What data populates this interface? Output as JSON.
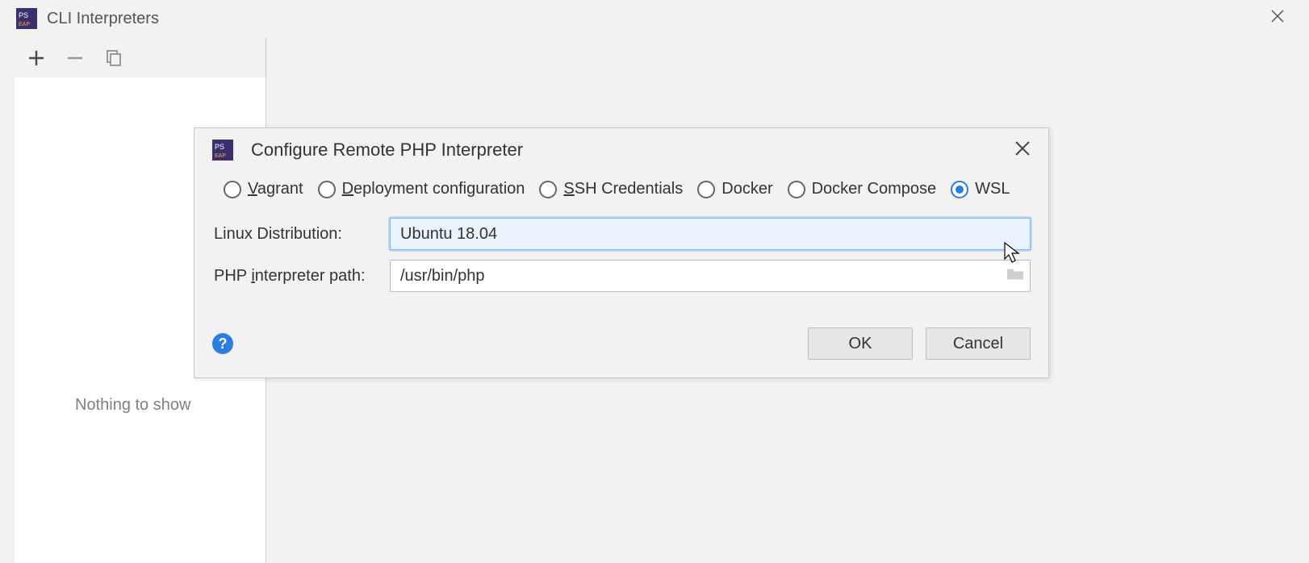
{
  "outer_dialog": {
    "title": "CLI Interpreters",
    "empty_text": "Nothing to show"
  },
  "modal": {
    "title": "Configure Remote PHP Interpreter",
    "radios": {
      "vagrant": "Vagrant",
      "deployment": "Deployment configuration",
      "ssh": "SSH Credentials",
      "docker": "Docker",
      "docker_compose": "Docker Compose",
      "wsl": "WSL"
    },
    "selected_radio": "wsl",
    "fields": {
      "distro_label": "Linux Distribution:",
      "distro_value": "Ubuntu 18.04",
      "path_label": "PHP interpreter path:",
      "path_value": "/usr/bin/php"
    },
    "buttons": {
      "ok": "OK",
      "cancel": "Cancel"
    }
  }
}
